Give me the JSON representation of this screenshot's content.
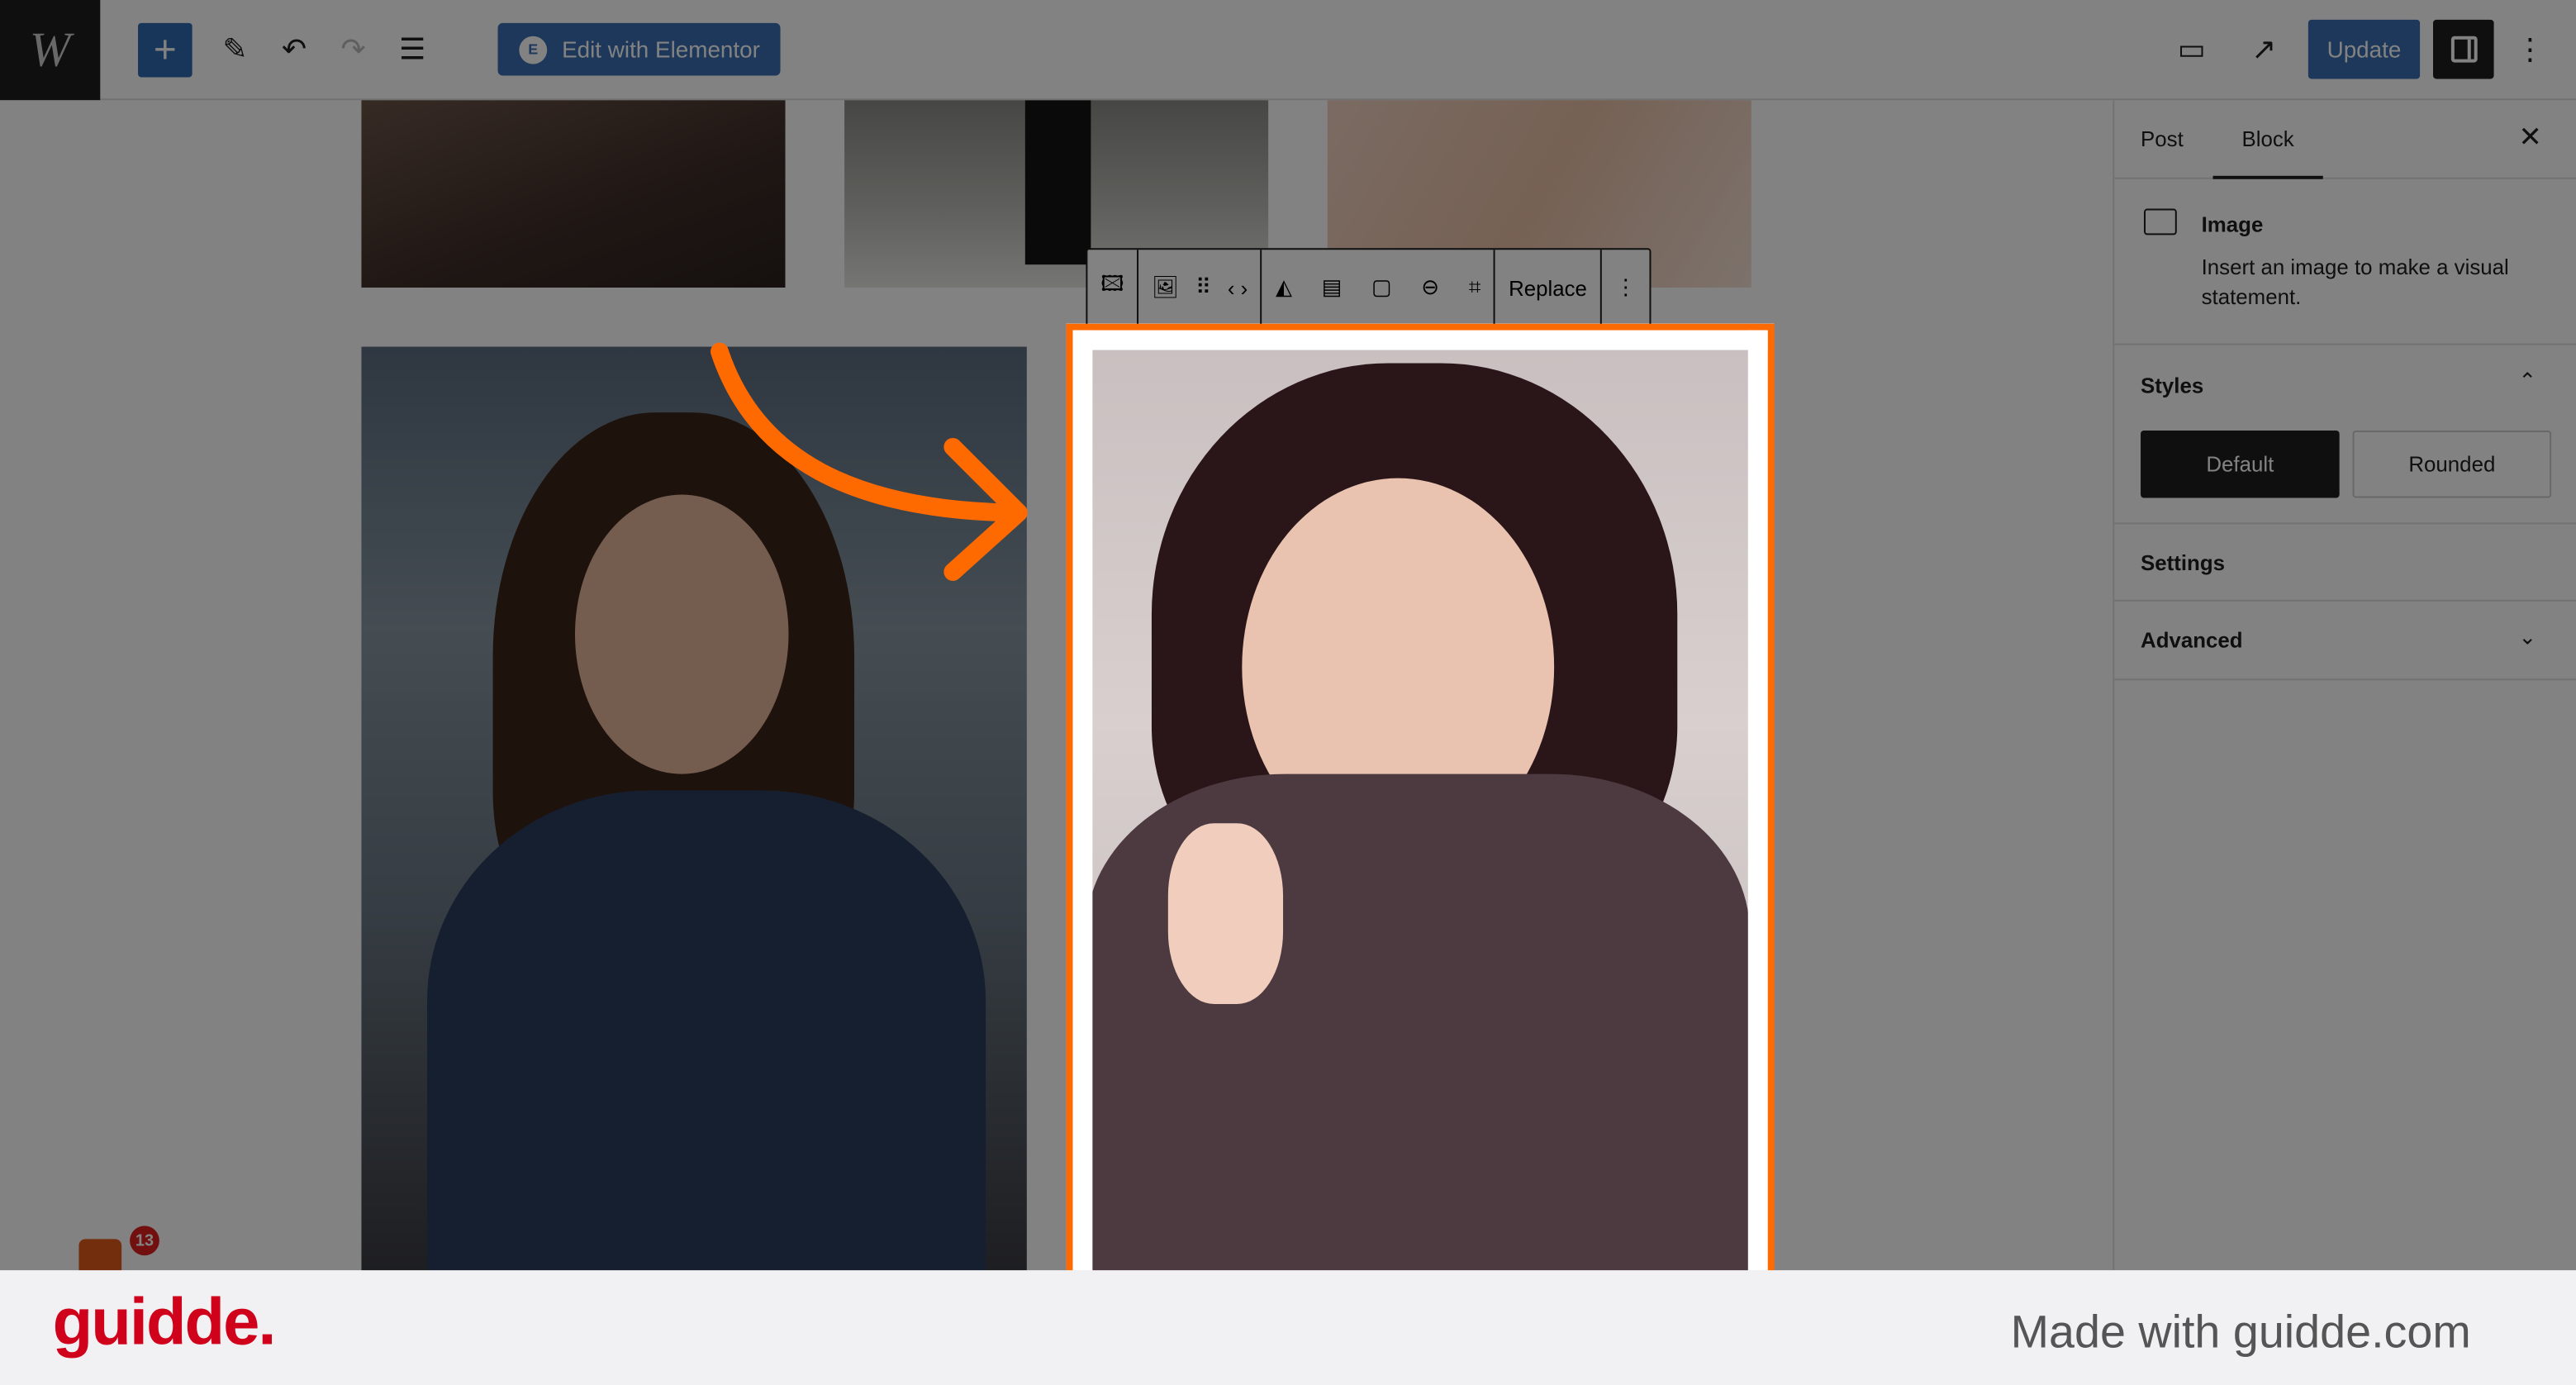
{
  "topbar": {
    "logo_text": "W",
    "elementor_label": "Edit with Elementor",
    "update_label": "Update"
  },
  "toolbar": {
    "replace_label": "Replace"
  },
  "sidebar": {
    "tabs": [
      {
        "label": "Post"
      },
      {
        "label": "Block",
        "active": true
      }
    ],
    "block": {
      "title": "Image",
      "description": "Insert an image to make a visual statement."
    },
    "styles": {
      "title": "Styles",
      "options": [
        "Default",
        "Rounded"
      ],
      "selected": "Default"
    },
    "settings": "Settings",
    "advanced": "Advanced"
  },
  "notification_count": "13",
  "footer": {
    "brand": "guidde.",
    "made_with": "Made with guidde.com"
  },
  "colors": {
    "accent": "#3a6fb0",
    "highlight": "#ff6a00",
    "brand": "#d0021b"
  }
}
